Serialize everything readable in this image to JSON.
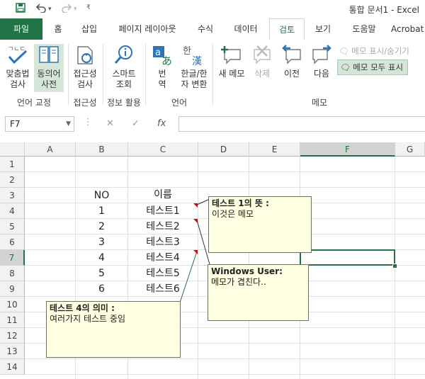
{
  "titlebar": {
    "doc_title": "통합 문서1  -  Excel",
    "qat": [
      "save-icon",
      "undo-icon",
      "redo-icon",
      "customize-icon"
    ]
  },
  "tabs": [
    {
      "label": "파일",
      "state": "file"
    },
    {
      "label": "홈",
      "state": ""
    },
    {
      "label": "삽입",
      "state": ""
    },
    {
      "label": "페이지 레이아웃",
      "state": ""
    },
    {
      "label": "수식",
      "state": ""
    },
    {
      "label": "데이터",
      "state": ""
    },
    {
      "label": "검토",
      "state": "active"
    },
    {
      "label": "보기",
      "state": ""
    },
    {
      "label": "도움말",
      "state": ""
    },
    {
      "label": "Acrobat",
      "state": ""
    }
  ],
  "ribbon": {
    "spelling": {
      "line1": "맞춤법",
      "line2": "검사"
    },
    "thesaurus": {
      "line1": "동의어",
      "line2": "사전"
    },
    "group_proofing": "언어 교정",
    "accessibility": {
      "line1": "접근성",
      "line2": "검사"
    },
    "group_access": "접근성",
    "smart_lookup": {
      "line1": "스마트",
      "line2": "조회"
    },
    "group_insights": "정보 활용",
    "translate": {
      "line1": "번",
      "line2": "역"
    },
    "hanja": {
      "line1": "한글/한",
      "line2": "자 변환"
    },
    "group_language": "언어",
    "new_comment": "새 메모",
    "delete": "삭제",
    "previous": "이전",
    "next": "다음",
    "show_hide": "메모 표시/숨기기",
    "show_all": "메모 모두 표시",
    "group_comments": "메모"
  },
  "formula_bar": {
    "name_box": "F7",
    "cancel_icon": "✕",
    "enter_icon": "✓",
    "fx": "fx",
    "content": ""
  },
  "grid": {
    "columns": [
      "A",
      "B",
      "C",
      "D",
      "E",
      "F",
      "G"
    ],
    "rows": [
      "1",
      "2",
      "3",
      "4",
      "5",
      "6",
      "7",
      "8",
      "9",
      "10",
      "11",
      "12",
      "13",
      "14"
    ],
    "selected_column": "F",
    "selected_row": "7",
    "cells": [
      {
        "b": "NO",
        "c": "이름"
      },
      {
        "b": "1",
        "c": "테스트1"
      },
      {
        "b": "2",
        "c": "테스트2"
      },
      {
        "b": "3",
        "c": "테스트3"
      },
      {
        "b": "4",
        "c": "테스트4"
      },
      {
        "b": "5",
        "c": "테스트5"
      },
      {
        "b": "6",
        "c": "테스트6"
      }
    ]
  },
  "notes": [
    {
      "author": "테스트 1의 뜻 :",
      "text": "이것은 메모"
    },
    {
      "author": "Windows User:",
      "text": "메모가 겹친다.."
    },
    {
      "author": "테스트 4의 의미 :",
      "text": "여러가지 테스트 중임"
    }
  ],
  "colors": {
    "accent": "#217346",
    "note_bg": "#ffffe1",
    "indicator": "#e00000"
  }
}
